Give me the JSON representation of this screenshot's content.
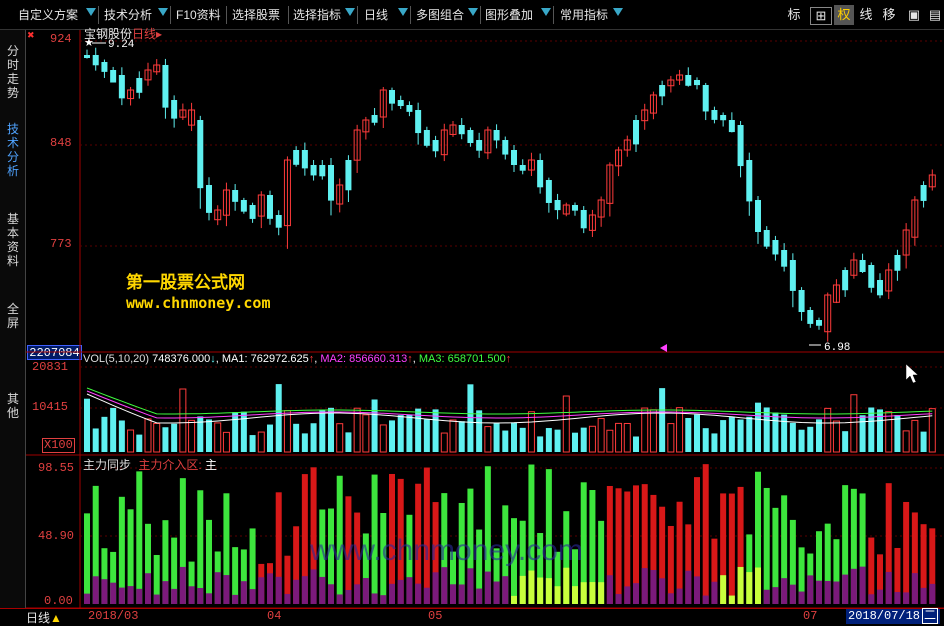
{
  "toolbar": {
    "items": [
      {
        "label": "自定义方案",
        "arrow": true
      },
      {
        "label": "技术分析",
        "arrow": true
      },
      {
        "label": "F10资料",
        "arrow": false
      },
      {
        "label": "选择股票",
        "arrow": false
      },
      {
        "label": "选择指标",
        "arrow": true
      },
      {
        "label": "日线",
        "arrow": true
      },
      {
        "label": "多图组合",
        "arrow": true
      },
      {
        "label": "图形叠加",
        "arrow": true
      },
      {
        "label": "常用指标",
        "arrow": true
      }
    ],
    "right": [
      "标",
      "⊞",
      "权",
      "线",
      "移",
      "▣",
      "▤"
    ]
  },
  "sidebar": {
    "tabs": [
      "分时走势",
      "技术分析",
      "基本资料",
      "全屏",
      "其他"
    ],
    "active_index": 1
  },
  "price_panel": {
    "stock_name": "宝钢股份",
    "period": "日线",
    "high_marker": "9.24",
    "low_marker": "6.98",
    "axis_labels": [
      "924",
      "848",
      "773"
    ],
    "left_box_value": "2207084",
    "watermark_cn": "第一股票公式网",
    "watermark_url": "www.chnmoney.com"
  },
  "volume_panel": {
    "title": "VOL(5,10,20)",
    "vol_value": "748376.000",
    "vol_arrow": "↓",
    "ma1_label": "MA1:",
    "ma1_value": "762972.625",
    "ma1_arrow": "↑",
    "ma2_label": "MA2:",
    "ma2_value": "856660.313",
    "ma2_arrow": "↑",
    "ma3_label": "MA3:",
    "ma3_value": "658701.500",
    "ma3_arrow": "↑",
    "axis_labels": [
      "20831",
      "10415"
    ],
    "multiplier": "X100"
  },
  "indicator_panel": {
    "title": "主力同步",
    "line1": "主力介入区:",
    "line2": "主",
    "axis_labels": [
      "98.55",
      "48.90",
      "0.00"
    ]
  },
  "bottom": {
    "period_label": "日线",
    "dates": [
      "2018/03",
      "04",
      "05",
      "07"
    ],
    "current_date": "2018/07/18",
    "current_suffix": "二"
  },
  "colors": {
    "up": "#ff3b3b",
    "down": "#5ff0f0",
    "axis": "#e04040",
    "ma1": "#ffffff",
    "ma2": "#ff40ff",
    "ma3": "#40ff40",
    "green_bar": "#3de63d",
    "red_bar": "#d81818",
    "purple_bar": "#7b1a7b",
    "yellow_green": "#c8ff3c",
    "watermark": "#ffd700"
  }
}
